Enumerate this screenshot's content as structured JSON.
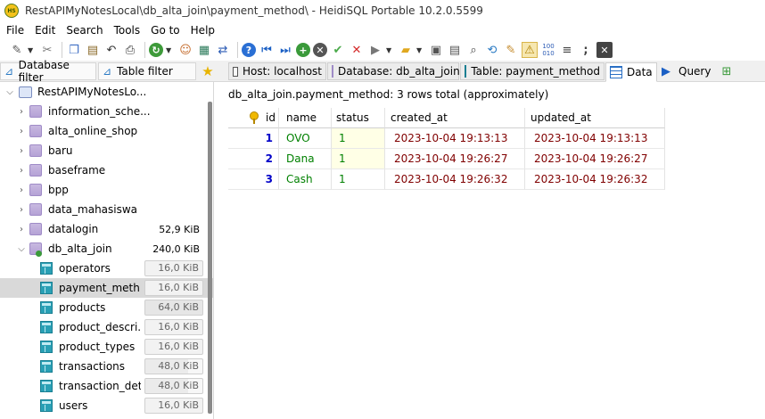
{
  "window": {
    "title": "RestAPIMyNotesLocal\\db_alta_join\\payment_method\\ - HeidiSQL Portable 10.2.0.5599",
    "icon_text": "HS"
  },
  "menu": [
    "File",
    "Edit",
    "Search",
    "Tools",
    "Go to",
    "Help"
  ],
  "toolbar": {
    "icons": [
      "connect-icon",
      "disconnect-icon",
      "copy-icon",
      "paste-icon",
      "undo-icon",
      "print-icon",
      "refresh-icon",
      "user-manager-icon",
      "export-icon",
      "transfer-icon",
      "help-icon",
      "first-record-icon",
      "last-record-icon",
      "insert-record-icon",
      "cancel-record-icon",
      "post-record-icon",
      "delete-record-icon",
      "run-icon",
      "open-file-icon",
      "save-icon",
      "save-as-icon",
      "find-icon",
      "replace-icon",
      "format-icon",
      "warning-icon",
      "binary-icon",
      "wrap-icon",
      "semicolon-icon",
      "close-tab-icon"
    ]
  },
  "filters": {
    "database_filter": "Database filter",
    "table_filter": "Table filter"
  },
  "tabs": [
    {
      "label": "Host: localhost"
    },
    {
      "label": "Database: db_alta_join"
    },
    {
      "label": "Table: payment_method"
    },
    {
      "label": "Data"
    },
    {
      "label": "Query"
    }
  ],
  "tree": {
    "root": "RestAPIMyNotesLo...",
    "databases": [
      {
        "name": "information_sche...",
        "size": ""
      },
      {
        "name": "alta_online_shop",
        "size": ""
      },
      {
        "name": "baru",
        "size": ""
      },
      {
        "name": "baseframe",
        "size": ""
      },
      {
        "name": "bpp",
        "size": ""
      },
      {
        "name": "data_mahasiswa",
        "size": ""
      },
      {
        "name": "datalogin",
        "size": "52,9 KiB"
      },
      {
        "name": "db_alta_join",
        "size": "240,0 KiB"
      }
    ],
    "tables": [
      {
        "name": "operators",
        "size": "16,0 KiB",
        "fraction": 0.25
      },
      {
        "name": "payment_meth...",
        "size": "16,0 KiB",
        "fraction": 0.25
      },
      {
        "name": "products",
        "size": "64,0 KiB",
        "fraction": 1.0
      },
      {
        "name": "product_descri...",
        "size": "16,0 KiB",
        "fraction": 0.25
      },
      {
        "name": "product_types",
        "size": "16,0 KiB",
        "fraction": 0.25
      },
      {
        "name": "transactions",
        "size": "48,0 KiB",
        "fraction": 0.75
      },
      {
        "name": "transaction_det...",
        "size": "48,0 KiB",
        "fraction": 0.75
      },
      {
        "name": "users",
        "size": "16,0 KiB",
        "fraction": 0.25
      }
    ]
  },
  "grid": {
    "info": "db_alta_join.payment_method: 3 rows total (approximately)",
    "columns": [
      "id",
      "name",
      "status",
      "created_at",
      "updated_at"
    ],
    "rows": [
      {
        "id": "1",
        "name": "OVO",
        "status": "1",
        "created_at": "2023-10-04 19:13:13",
        "updated_at": "2023-10-04 19:13:13"
      },
      {
        "id": "2",
        "name": "Dana",
        "status": "1",
        "created_at": "2023-10-04 19:26:27",
        "updated_at": "2023-10-04 19:26:27"
      },
      {
        "id": "3",
        "name": "Cash",
        "status": "1",
        "created_at": "2023-10-04 19:26:32",
        "updated_at": "2023-10-04 19:26:32"
      }
    ]
  },
  "colors": {
    "number": "#0000c8",
    "string": "#008000",
    "datetime": "#800000",
    "selection": "#d9d9d9"
  }
}
